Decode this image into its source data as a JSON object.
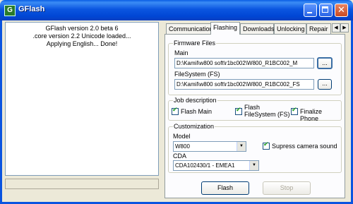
{
  "window": {
    "title": "GFlash"
  },
  "log": {
    "lines": [
      "GFlash version 2.0 beta 6",
      ".core version 2.2 Unicode loaded...",
      "Applying English... Done!"
    ]
  },
  "tabs": [
    "Communication",
    "Flashing",
    "Downloads",
    "Unlocking",
    "Repair"
  ],
  "firmware": {
    "group_label": "Firmware Files",
    "main_label": "Main",
    "main_value": "D:\\Kamil\\w800 soft\\r1bc002\\W800_R1BC002_M",
    "fs_label": "FileSystem (FS)",
    "fs_value": "D:\\Kamil\\w800 soft\\r1bc002\\W800_R1BC002_FS",
    "browse_label": "..."
  },
  "job": {
    "group_label": "Job description",
    "flash_main": "Flash Main",
    "flash_fs_line1": "Flash",
    "flash_fs_line2": "FileSystem (FS)",
    "finalize": "Finalize Phone"
  },
  "custom": {
    "group_label": "Customization",
    "model_label": "Model",
    "model_value": "W800",
    "camera_label": "Supress camera sound",
    "cda_label": "CDA",
    "cda_value": "CDA102430/1 - EMEA1"
  },
  "actions": {
    "flash": "Flash",
    "stop": "Stop"
  },
  "colors": {
    "titlebar": "#0a5de4",
    "window_bg": "#ece9d8",
    "check": "#21a121"
  }
}
